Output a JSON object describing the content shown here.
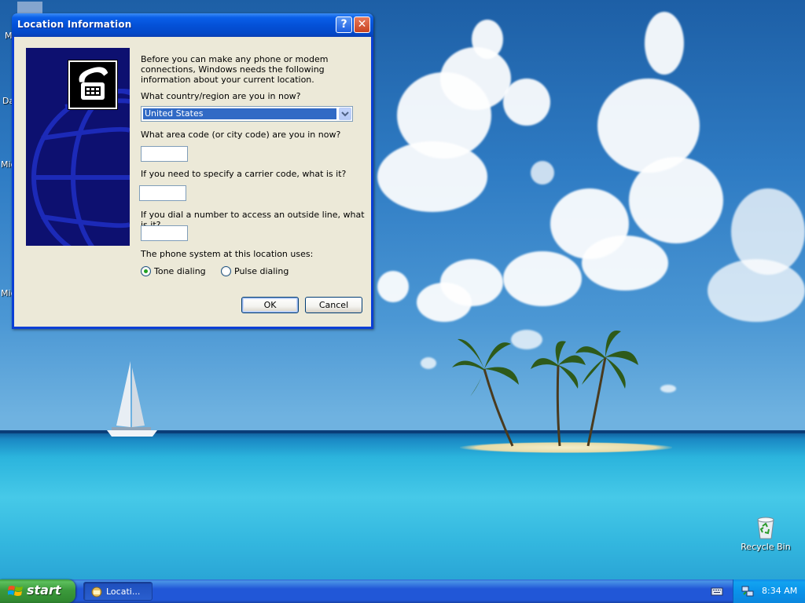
{
  "desktop": {
    "partial_labels": [
      "M",
      "Da",
      "Mic",
      "Mic"
    ],
    "recycle_bin_label": "Recycle Bin"
  },
  "dialog": {
    "title": "Location Information",
    "help_button": "?",
    "close_button": "✕",
    "intro": "Before you can make any phone or modem connections, Windows needs the following information about your current location.",
    "country_label": "What country/region are you in now?",
    "country_value": "United States",
    "area_code_label": "What area code (or city code) are you in now?",
    "area_code_value": "",
    "carrier_code_label": "If you need to specify a carrier code, what is it?",
    "carrier_code_value": "",
    "outside_line_label": "If you dial a number to access an outside line, what is it?",
    "outside_line_value": "",
    "phone_system_label": "The phone system at this location uses:",
    "dialing_options": [
      {
        "label": "Tone dialing",
        "selected": true
      },
      {
        "label": "Pulse dialing",
        "selected": false
      }
    ],
    "ok_label": "OK",
    "cancel_label": "Cancel"
  },
  "taskbar": {
    "start_label": "start",
    "task_button_label": "Locati...",
    "clock": "8:34 AM"
  },
  "colors": {
    "titlebar": "#0451d8",
    "dialog_bg": "#ece9d8",
    "selection": "#316ac5",
    "start_green": "#3c9a3c",
    "taskbar_blue": "#2157d7",
    "tray_blue": "#0b87de"
  },
  "icons": [
    "telephone-icon",
    "globe-graphic",
    "dropdown-arrow-icon",
    "windows-logo-icon",
    "dialog-task-icon",
    "keyboard-icon",
    "network-icon",
    "recycle-bin-icon"
  ]
}
